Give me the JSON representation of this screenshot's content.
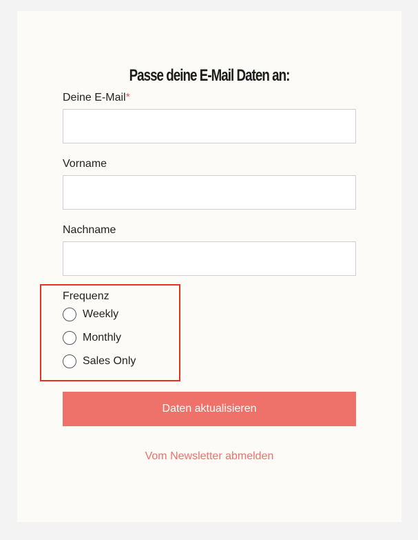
{
  "form": {
    "title": "Passe deine E-Mail Daten an:",
    "email": {
      "label": "Deine E-Mail",
      "required_marker": "*",
      "value": ""
    },
    "firstname": {
      "label": "Vorname",
      "value": ""
    },
    "lastname": {
      "label": "Nachname",
      "value": ""
    },
    "frequency": {
      "label": "Frequenz",
      "options": [
        {
          "label": "Weekly",
          "selected": false
        },
        {
          "label": "Monthly",
          "selected": false
        },
        {
          "label": "Sales Only",
          "selected": false
        }
      ]
    },
    "submit_label": "Daten aktualisieren",
    "unsubscribe_label": "Vom Newsletter abmelden"
  },
  "colors": {
    "page_background": "#f3f3f3",
    "card_background": "#fcfbf7",
    "accent": "#ee716a",
    "highlight_border": "#e3321e",
    "required_marker": "#e0625b"
  }
}
